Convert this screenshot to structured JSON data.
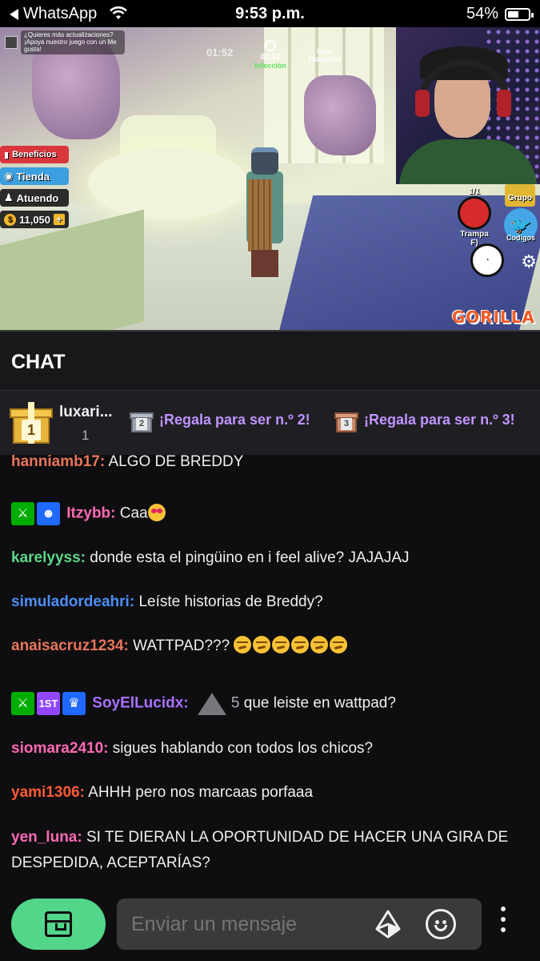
{
  "status_bar": {
    "back_app": "WhatsApp",
    "time": "9:53 p.m.",
    "battery": "54%",
    "battery_level": 0.54
  },
  "stream": {
    "hud": {
      "notice": "¿Quieres más actualizaciones? ¡Apoya nuestro juego con un Me gusta!",
      "timer": "01:52",
      "clock": "02:32",
      "mode": "Infección",
      "map_label": "Mapa",
      "map_name": "Hospital",
      "beneficios": "Beneficios",
      "tienda": "Tienda",
      "atuendo": "Atuendo",
      "coins": "11,050",
      "grupo": "Grupo",
      "trampa_count": "1/1",
      "trampa": "Trampa",
      "trampa_key": "F)",
      "codigos": "Codigos",
      "brand": "GORILLA"
    }
  },
  "chat": {
    "title": "CHAT",
    "gifts": {
      "first_name": "luxari...",
      "first_count": "1",
      "rank2_number": "2",
      "rank2_cta": "¡Regala para ser n.º 2!",
      "rank3_number": "3",
      "rank3_cta": "¡Regala para ser n.º 3!"
    },
    "messages": [
      {
        "user": "hanniamb17",
        "color": "#e8755a",
        "text": "ALGO DE BREDDY"
      },
      {
        "user": "Itzybb",
        "color": "#ff69b4",
        "text": "Caa",
        "badges": [
          "sword-badge",
          "spy-badge"
        ],
        "emoji": "heart-eyes"
      },
      {
        "user": "karelyyss",
        "color": "#5ed68a",
        "text": "donde esta el pingüino en i feel alive? JAJAJAJ"
      },
      {
        "user": "simuladordeahri",
        "color": "#4d8ef7",
        "text": "Leíste historias de Breddy?"
      },
      {
        "user": "anaisacruz1234",
        "color": "#e8755a",
        "text": "WATTPAD???",
        "emoji_count": 6
      },
      {
        "user": "SoyElLucidx",
        "color": "#a970ff",
        "text": "que leiste en wattpad?",
        "badges": [
          "sword-badge",
          "1st-badge",
          "crown-badge"
        ],
        "count": "5"
      },
      {
        "user": "siomara2410",
        "color": "#ff69b4",
        "text": "sigues hablando con todos los chicos?"
      },
      {
        "user": "yami1306",
        "color": "#ff5a36",
        "text": "AHHH pero nos marcaas porfaaa"
      },
      {
        "user": "yen_luna",
        "color": "#ff69b4",
        "text_line1": "SI TE DIERAN LA OPORTUNIDAD DE HACER UNA GIRA DE",
        "text_line2": "DESPEDIDA, ACEPTARÍAS?"
      }
    ],
    "input": {
      "placeholder": "Enviar un mensaje"
    }
  },
  "icons": [
    "wifi-icon",
    "battery-icon",
    "store-icon",
    "bits-icon",
    "emote-icon",
    "more-icon"
  ],
  "colors": {
    "background": "#0e0e10",
    "accent_purple": "#bf94ff",
    "store_green": "#52d68a"
  }
}
